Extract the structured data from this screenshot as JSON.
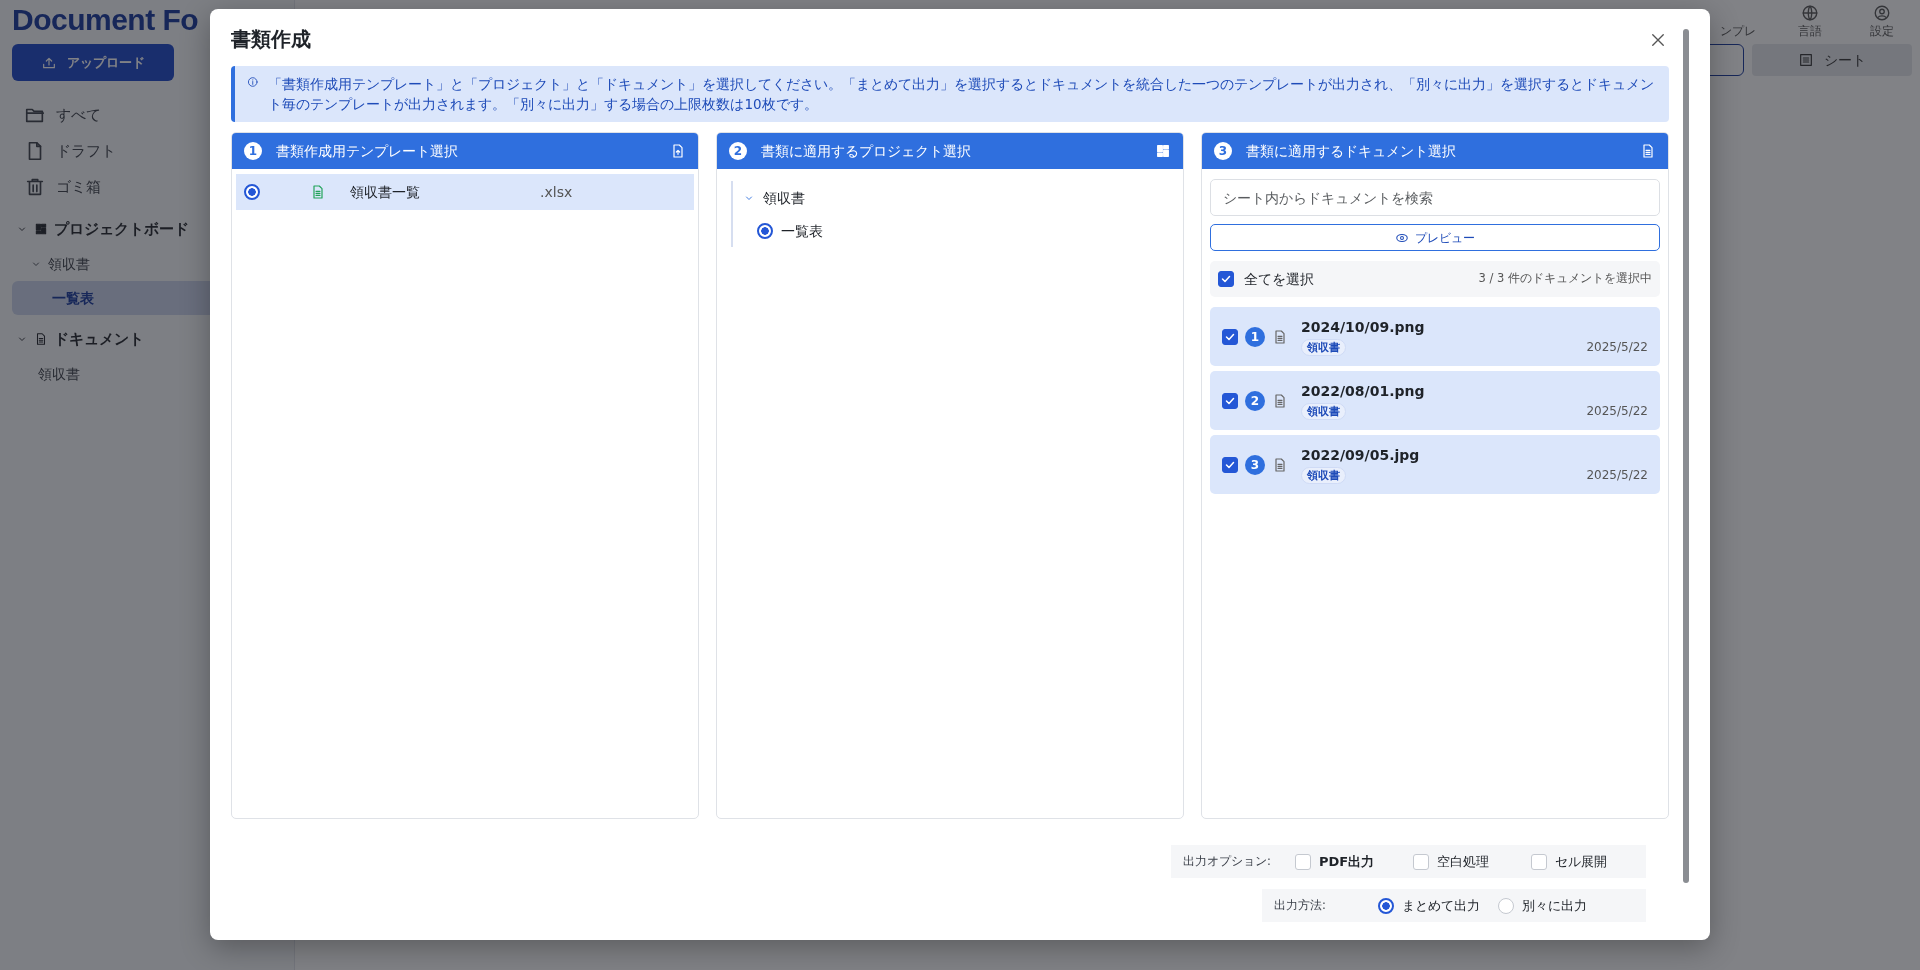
{
  "app": {
    "logo": "Document Fo",
    "upload_button": "アップロード",
    "nav": [
      {
        "label": "すべて",
        "kind": "folder"
      },
      {
        "label": "ドラフト",
        "kind": "file"
      },
      {
        "label": "ゴミ箱",
        "kind": "trash"
      }
    ],
    "sections": [
      {
        "label": "プロジェクトボード",
        "kind": "grid",
        "expanded": true,
        "children": [
          {
            "label": "領収書",
            "expanded": true,
            "selected": false,
            "children": [
              {
                "label": "一覧表",
                "selected": true
              }
            ]
          }
        ]
      },
      {
        "label": "ドキュメント",
        "kind": "doc",
        "expanded": true,
        "children": [
          {
            "label": "領収書",
            "selected": false
          }
        ]
      }
    ],
    "toolbar": [
      {
        "label": "ンプレ",
        "kind": "none"
      },
      {
        "label": "言語",
        "kind": "globe"
      },
      {
        "label": "設定",
        "kind": "user"
      }
    ],
    "sheet_button": "シート"
  },
  "dialog": {
    "title": "書類作成",
    "info": "「書類作成用テンプレート」と「プロジェクト」と「ドキュメント」を選択してください。「まとめて出力」を選択するとドキュメントを統合した一つのテンプレートが出力され、「別々に出力」を選択するとドキュメント毎のテンプレートが出力されます。「別々に出力」する場合の上限枚数は10枚です。",
    "steps": [
      {
        "number": "1",
        "title": "書類作成用テンプレート選択",
        "kind": "templates",
        "items": [
          {
            "name": "領収書一覧",
            "ext": ".xlsx",
            "selected": true
          }
        ]
      },
      {
        "number": "2",
        "title": "書類に適用するプロジェクト選択",
        "kind": "projects",
        "tree": [
          {
            "label": "領収書",
            "expanded": true,
            "children": [
              {
                "label": "一覧表",
                "selected": true
              }
            ]
          }
        ]
      },
      {
        "number": "3",
        "title": "書類に適用するドキュメント選択",
        "kind": "documents",
        "search": {
          "placeholder": "シート内からドキュメントを検索"
        },
        "preview_button": "プレビュー",
        "select_all": {
          "label": "全てを選択",
          "checked": true
        },
        "count": "3 / 3 件のドキュメントを選択中",
        "documents": [
          {
            "number": "1",
            "name": "2024/10/09.png",
            "tag": "領収書",
            "date": "2025/5/22",
            "checked": true
          },
          {
            "number": "2",
            "name": "2022/08/01.png",
            "tag": "領収書",
            "date": "2025/5/22",
            "checked": true
          },
          {
            "number": "3",
            "name": "2022/09/05.jpg",
            "tag": "領収書",
            "date": "2025/5/22",
            "checked": true
          }
        ]
      }
    ],
    "output_options": {
      "label": "出力オプション:",
      "options": [
        {
          "label": "PDF出力",
          "checked": false
        },
        {
          "label": "空白処理",
          "checked": false
        },
        {
          "label": "セル展開",
          "checked": false
        }
      ]
    },
    "output_method": {
      "label": "出力方法:",
      "options": [
        {
          "label": "まとめて出力",
          "selected": true
        },
        {
          "label": "別々に出力",
          "selected": false
        }
      ]
    }
  }
}
